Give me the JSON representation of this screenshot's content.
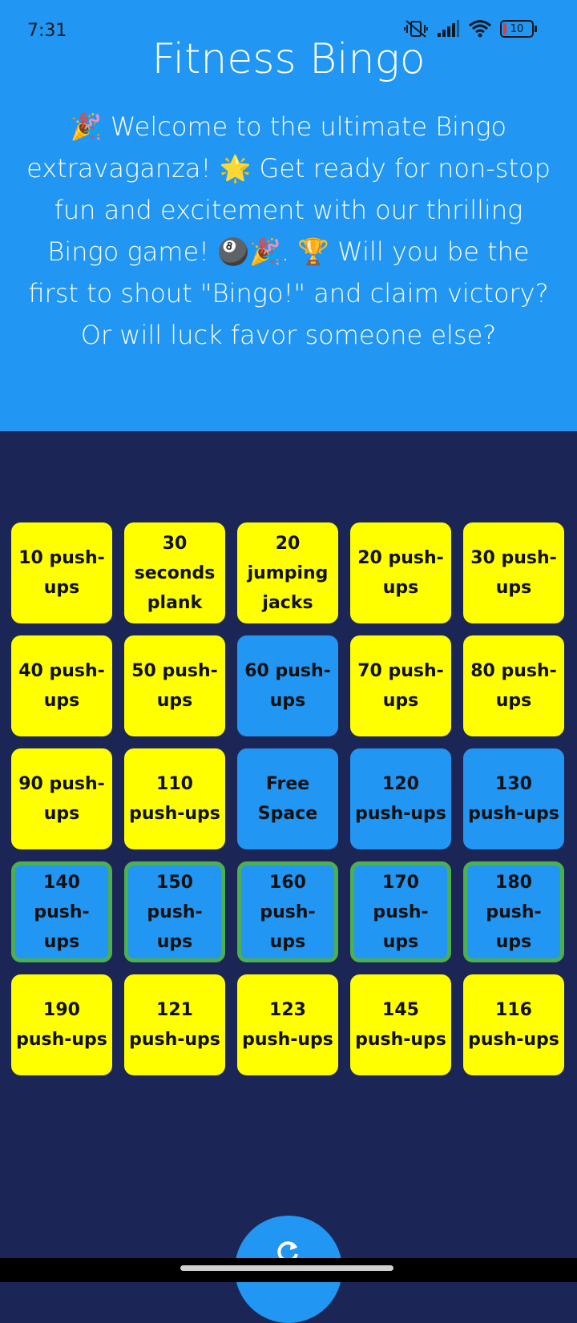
{
  "status_bar": {
    "time": "7:31",
    "battery_level": "10",
    "icons": [
      "vibrate-off-icon",
      "signal-icon",
      "wifi-icon",
      "battery-icon"
    ]
  },
  "header": {
    "title": "Fitness Bingo",
    "welcome": "🎉 Welcome to the ultimate Bingo extravaganza! 🌟 Get ready for non-stop fun and excitement with our thrilling Bingo game! 🎱🎉. 🏆 Will you be the first to shout \"Bingo!\" and claim victory? Or will luck favor someone else?"
  },
  "colors": {
    "header_bg": "#2196f3",
    "page_bg": "#1c2656",
    "cell_unmarked": "#ffff00",
    "cell_marked": "#2196f3",
    "win_border": "#4caf50"
  },
  "board": {
    "cells": [
      {
        "label": "10 push-ups",
        "marked": false,
        "winning": false
      },
      {
        "label": "30 seconds plank",
        "marked": false,
        "winning": false
      },
      {
        "label": "20 jumping jacks",
        "marked": false,
        "winning": false
      },
      {
        "label": "20 push-ups",
        "marked": false,
        "winning": false
      },
      {
        "label": "30 push-ups",
        "marked": false,
        "winning": false
      },
      {
        "label": "40 push-ups",
        "marked": false,
        "winning": false
      },
      {
        "label": "50 push-ups",
        "marked": false,
        "winning": false
      },
      {
        "label": "60 push-ups",
        "marked": true,
        "winning": false
      },
      {
        "label": "70 push-ups",
        "marked": false,
        "winning": false
      },
      {
        "label": "80 push-ups",
        "marked": false,
        "winning": false
      },
      {
        "label": "90 push-ups",
        "marked": false,
        "winning": false
      },
      {
        "label": "110 push-ups",
        "marked": false,
        "winning": false
      },
      {
        "label": "Free Space",
        "marked": true,
        "winning": false
      },
      {
        "label": "120 push-ups",
        "marked": true,
        "winning": false
      },
      {
        "label": "130 push-ups",
        "marked": true,
        "winning": false
      },
      {
        "label": "140 push-ups",
        "marked": true,
        "winning": true
      },
      {
        "label": "150 push-ups",
        "marked": true,
        "winning": true
      },
      {
        "label": "160 push-ups",
        "marked": true,
        "winning": true
      },
      {
        "label": "170 push-ups",
        "marked": true,
        "winning": true
      },
      {
        "label": "180 push-ups",
        "marked": true,
        "winning": true
      },
      {
        "label": "190 push-ups",
        "marked": false,
        "winning": false
      },
      {
        "label": "121 push-ups",
        "marked": false,
        "winning": false
      },
      {
        "label": "123 push-ups",
        "marked": false,
        "winning": false
      },
      {
        "label": "145 push-ups",
        "marked": false,
        "winning": false
      },
      {
        "label": "116 push-ups",
        "marked": false,
        "winning": false
      }
    ]
  },
  "fab": {
    "icon": "refresh-icon"
  }
}
